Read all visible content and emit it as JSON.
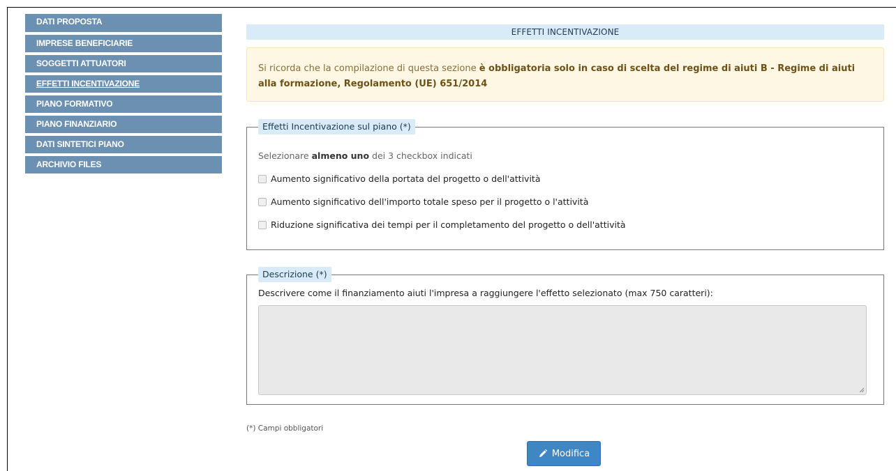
{
  "sidebar": {
    "items": [
      {
        "label": "DATI PROPOSTA"
      },
      {
        "label": "IMPRESE BENEFICIARIE"
      },
      {
        "label": "SOGGETTI ATTUATORI"
      },
      {
        "label": "EFFETTI INCENTIVAZIONE",
        "active": true
      },
      {
        "label": "PIANO FORMATIVO"
      },
      {
        "label": "PIANO FINANZIARIO"
      },
      {
        "label": "DATI SINTETICI PIANO"
      },
      {
        "label": "ARCHIVIO FILES"
      }
    ]
  },
  "section": {
    "title": "EFFETTI INCENTIVAZIONE"
  },
  "alert": {
    "text_before": "Si ricorda che la compilazione di questa sezione ",
    "text_bold": "è obbligatoria solo in caso di scelta del regime di aiuti B - Regime di aiuti alla formazione, Regolamento (UE) 651/2014"
  },
  "effects": {
    "legend": "Effetti Incentivazione sul piano (*)",
    "hint_before": "Selezionare ",
    "hint_bold": "almeno uno",
    "hint_after": " dei 3 checkbox indicati",
    "options": [
      {
        "label": "Aumento significativo della portata del progetto o dell'attività",
        "checked": false
      },
      {
        "label": "Aumento significativo dell'importo totale speso per il progetto o l'attività",
        "checked": false
      },
      {
        "label": "Riduzione significativa dei tempi per il completamento del progetto o dell'attività",
        "checked": false
      }
    ]
  },
  "description": {
    "legend": "Descrizione (*)",
    "label": "Descrivere come il finanziamento aiuti l'impresa a raggiungere l'effetto selezionato (max 750 caratteri):",
    "value": ""
  },
  "footer": {
    "required_note": "(*) Campi obbligatori",
    "edit_button": "Modifica",
    "edit_icon": "pencil-icon"
  },
  "colors": {
    "sidebar_bg": "#6c90b2",
    "header_bg": "#d8ebf6",
    "alert_bg": "#fdf7e3",
    "button_bg": "#3e86c4"
  }
}
